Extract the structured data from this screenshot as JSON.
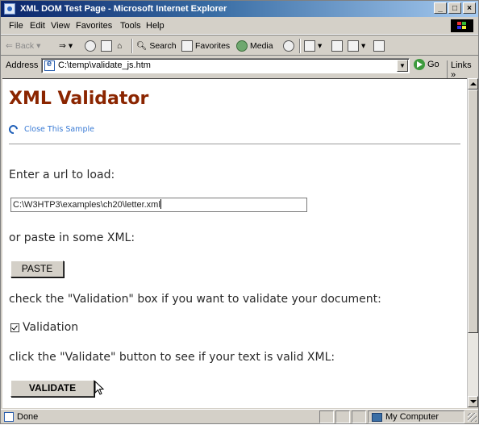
{
  "window": {
    "title": "XML DOM Test Page - Microsoft Internet Explorer"
  },
  "menubar": {
    "items": [
      "File",
      "Edit",
      "View",
      "Favorites",
      "Tools",
      "Help"
    ]
  },
  "toolbar": {
    "back": "Back",
    "search": "Search",
    "favorites": "Favorites",
    "media": "Media"
  },
  "addressbar": {
    "label": "Address",
    "url": "C:\\temp\\validate_js.htm",
    "go": "Go",
    "links": "Links »"
  },
  "page": {
    "title": "XML Validator",
    "close_link": "Close This Sample",
    "prompt_url": "Enter a url to load:",
    "url_value": "C:\\W3HTP3\\examples\\ch20\\letter.xml",
    "prompt_paste": "or paste in some XML:",
    "paste_button": "PASTE",
    "prompt_check": "check the \"Validation\" box if you want to validate your document:",
    "validation_label": "Validation",
    "validation_checked": true,
    "prompt_validate": "click the \"Validate\" button to see if your text is valid XML:",
    "validate_button": "VALIDATE"
  },
  "statusbar": {
    "status": "Done",
    "zone": "My Computer"
  }
}
